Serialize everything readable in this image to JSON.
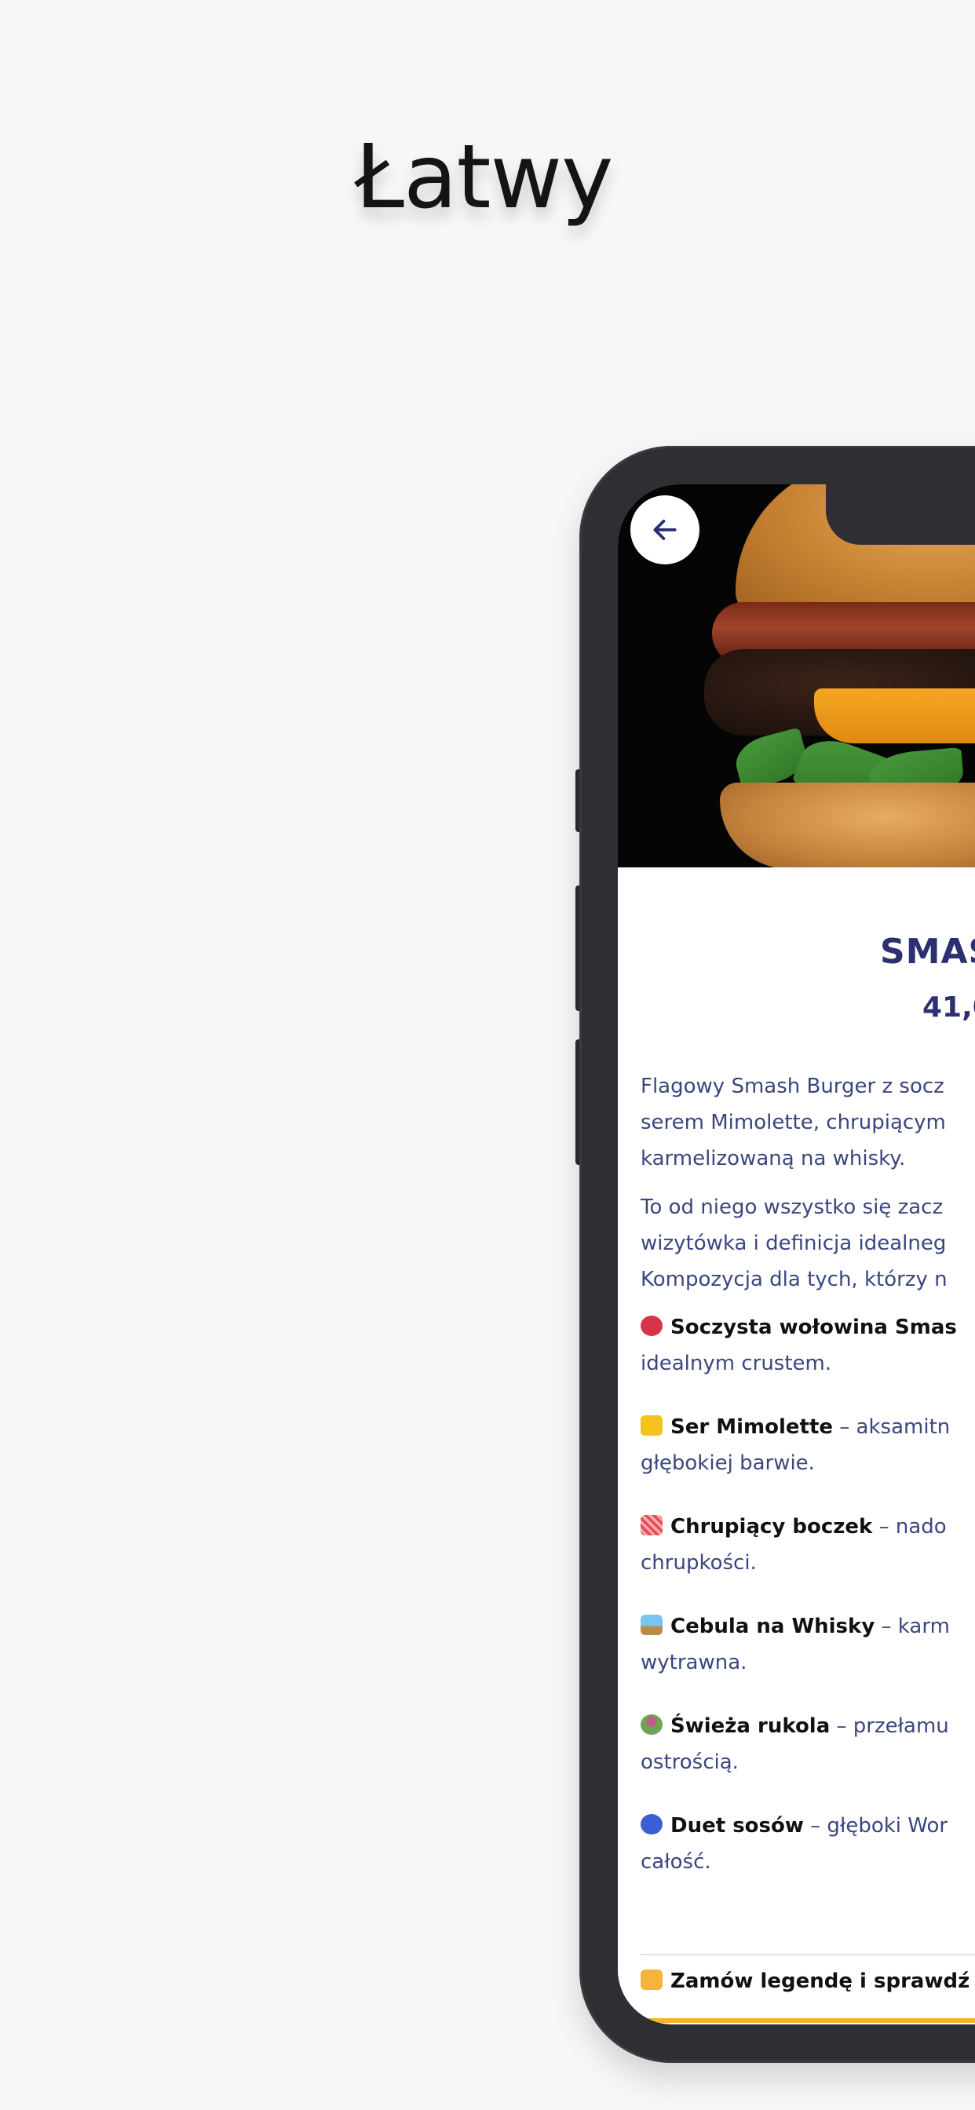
{
  "headline": "Łatwy",
  "product": {
    "name": "SMAS",
    "price": "41,0"
  },
  "description": [
    "Flagowy Smash Burger z socz",
    "serem Mimolette, chrupiącym",
    "karmelizowaną na whisky."
  ],
  "description2": [
    "To od niego wszystko się zacz",
    "wizytówka i definicja idealneg",
    "Kompozycja dla tych, którzy n"
  ],
  "features": [
    {
      "icon": "meat-icon",
      "color": "#d9334a",
      "title": "Soczysta wołowina Smas",
      "rest": "",
      "line2": "idealnym crustem."
    },
    {
      "icon": "cheese-icon",
      "color": "#f4c21c",
      "title": "Ser Mimolette",
      "rest": " – aksamitn",
      "line2": "głębokiej barwie."
    },
    {
      "icon": "bacon-icon",
      "color": "#e2525a",
      "title": "Chrupiący boczek",
      "rest": " – nado",
      "line2": "chrupkości."
    },
    {
      "icon": "onion-icon",
      "color": "#4a8bc8",
      "title": "Cebula na Whisky",
      "rest": " – karm",
      "line2": "wytrawna."
    },
    {
      "icon": "salad-icon",
      "color": "#6aa84f",
      "title": "Świeża rukola",
      "rest": " – przełamu",
      "line2": "ostrością."
    },
    {
      "icon": "sauce-icon",
      "color": "#3a5fd0",
      "title": "Duet sosów",
      "rest": " – głęboki Wor",
      "line2": "całość."
    }
  ],
  "cta": "Zamów legendę i sprawdź"
}
